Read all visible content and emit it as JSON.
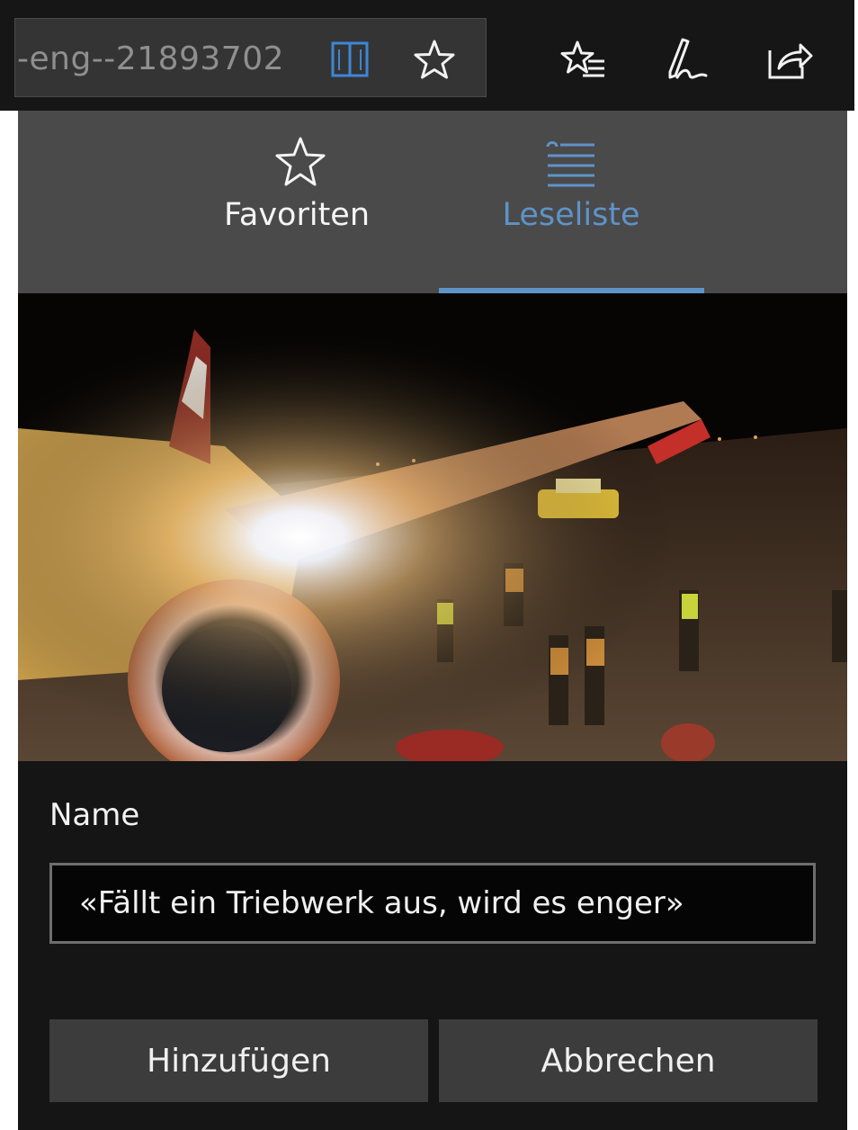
{
  "toolbar": {
    "url_text": "-eng--21893702",
    "icons": [
      "reading-view-icon",
      "add-favorite-star-icon",
      "favorites-list-icon",
      "web-note-pen-icon",
      "share-icon"
    ]
  },
  "panel": {
    "tabs": [
      {
        "label": "Favoriten",
        "icon": "star-outline-icon",
        "active": false
      },
      {
        "label": "Leseliste",
        "icon": "reading-list-icon",
        "active": true
      }
    ],
    "accent_color": "#5f93c8",
    "name_label": "Name",
    "name_value": "«Fällt ein Triebwerk aus, wird es enger»",
    "buttons": {
      "add": "Hinzufügen",
      "cancel": "Abbrechen"
    }
  }
}
